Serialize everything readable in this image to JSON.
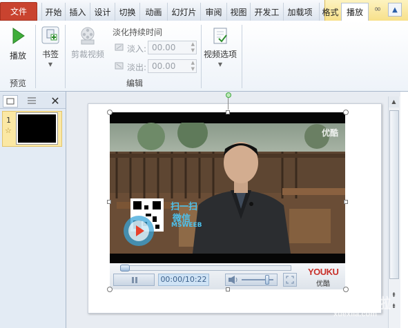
{
  "ribbon": {
    "file_tab": "文件",
    "tabs": [
      "开始",
      "插入",
      "设计",
      "切换",
      "动画",
      "幻灯片",
      "审阅",
      "视图",
      "开发工",
      "加载项",
      "格式",
      "播放"
    ],
    "groups": {
      "preview": {
        "label": "预览",
        "play": "播放"
      },
      "bookmark": {
        "label": "书签"
      },
      "edit": {
        "label": "编辑",
        "trim": "剪裁视频",
        "fade_title": "淡化持续时间",
        "fade_in_label": "淡入:",
        "fade_in_value": "00.00",
        "fade_out_label": "淡出:",
        "fade_out_value": "00.00"
      },
      "video_options": {
        "label": "视频选项"
      }
    }
  },
  "thumbnail": {
    "number": "1",
    "marker": "☆"
  },
  "video": {
    "corner_logo": "优酷",
    "qr_caption_1": "扫一扫",
    "qr_caption_2": "微信",
    "qr_caption_3": "MSWEEB",
    "time": "00:00/10:22",
    "brand": "YOUKU",
    "brand_sub": "优酷",
    "progress": 0.0,
    "volume": 0.8
  },
  "watermark": {
    "text": "xuexila.com",
    "glyphs": "学习啦"
  }
}
